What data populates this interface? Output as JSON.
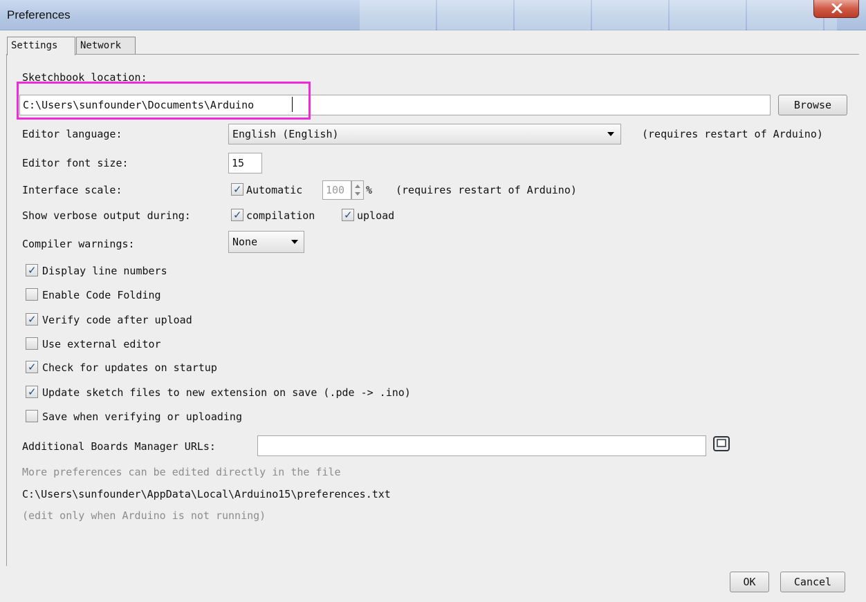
{
  "window": {
    "title": "Preferences"
  },
  "tabs": [
    {
      "label": "Settings",
      "active": true
    },
    {
      "label": "Network",
      "active": false
    }
  ],
  "sketchbook": {
    "label": "Sketchbook location:",
    "path": "C:\\Users\\sunfounder\\Documents\\Arduino",
    "browse_label": "Browse"
  },
  "editor_language": {
    "label": "Editor language:",
    "value": "English (English)",
    "note": "(requires restart of Arduino)"
  },
  "editor_font_size": {
    "label": "Editor font size:",
    "value": "15"
  },
  "interface_scale": {
    "label": "Interface scale:",
    "automatic_label": "Automatic",
    "automatic_checked": true,
    "value": "100",
    "unit": "%",
    "note": "(requires restart of Arduino)"
  },
  "verbose": {
    "label": "Show verbose output during:",
    "compilation_label": "compilation",
    "compilation_checked": true,
    "upload_label": "upload",
    "upload_checked": true
  },
  "compiler_warnings": {
    "label": "Compiler warnings:",
    "value": "None"
  },
  "options": [
    {
      "label": "Display line numbers",
      "checked": true
    },
    {
      "label": "Enable Code Folding",
      "checked": false
    },
    {
      "label": "Verify code after upload",
      "checked": true
    },
    {
      "label": "Use external editor",
      "checked": false
    },
    {
      "label": "Check for updates on startup",
      "checked": true
    },
    {
      "label": "Update sketch files to new extension on save (.pde -> .ino)",
      "checked": true
    },
    {
      "label": "Save when verifying or uploading",
      "checked": false
    }
  ],
  "boards_manager": {
    "label": "Additional Boards Manager URLs:",
    "value": ""
  },
  "footer": {
    "more_prefs": "More preferences can be edited directly in the file",
    "prefs_path": "C:\\Users\\sunfounder\\AppData\\Local\\Arduino15\\preferences.txt",
    "edit_note": "(edit only when Arduino is not running)"
  },
  "buttons": {
    "ok": "OK",
    "cancel": "Cancel"
  },
  "colors": {
    "highlight": "#ee2bd7",
    "checkmark": "#1f4e8a",
    "close_button": "#cf5a45"
  },
  "icons": {
    "close": "close-x-icon",
    "open_list": "window-list-icon",
    "checkmark": "checkmark-icon"
  }
}
